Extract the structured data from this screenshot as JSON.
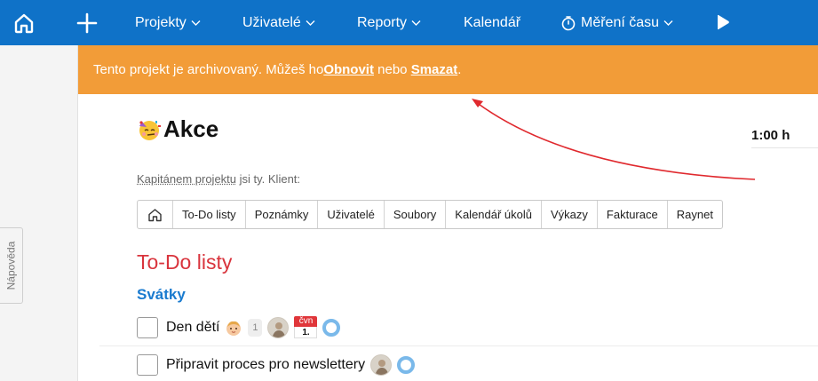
{
  "nav": {
    "items": [
      {
        "label": "Projekty",
        "has_dropdown": true
      },
      {
        "label": "Uživatelé",
        "has_dropdown": true
      },
      {
        "label": "Reporty",
        "has_dropdown": true
      },
      {
        "label": "Kalendář",
        "has_dropdown": false
      },
      {
        "label": "Měření času",
        "has_dropdown": true
      }
    ]
  },
  "sidebar": {
    "help_label": "Nápověda"
  },
  "banner": {
    "text_before": "Tento projekt je archivovaný. Můžeš ho ",
    "restore_label": "Obnovit",
    "text_middle": " nebo ",
    "delete_label": "Smazat",
    "text_after": "."
  },
  "project": {
    "title": "Akce",
    "time_total": "1:00 h",
    "captain_link": "Kapitánem projektu",
    "captain_rest": " jsi ty. Klient:"
  },
  "tabs": [
    "To-Do listy",
    "Poznámky",
    "Uživatelé",
    "Soubory",
    "Kalendář úkolů",
    "Výkazy",
    "Fakturace",
    "Raynet"
  ],
  "section": {
    "title": "To-Do listy"
  },
  "list": {
    "title": "Svátky",
    "tasks": [
      {
        "text": "Den dětí",
        "count": "1",
        "date_month": "čvn",
        "date_day": "1."
      },
      {
        "text": "Připravit proces pro newslettery"
      }
    ]
  },
  "colors": {
    "nav_bg": "#0f72c8",
    "banner_bg": "#f29c38",
    "section_title": "#d9343d",
    "list_title": "#1a7bcf",
    "annotation_arrow": "#e0292e"
  }
}
